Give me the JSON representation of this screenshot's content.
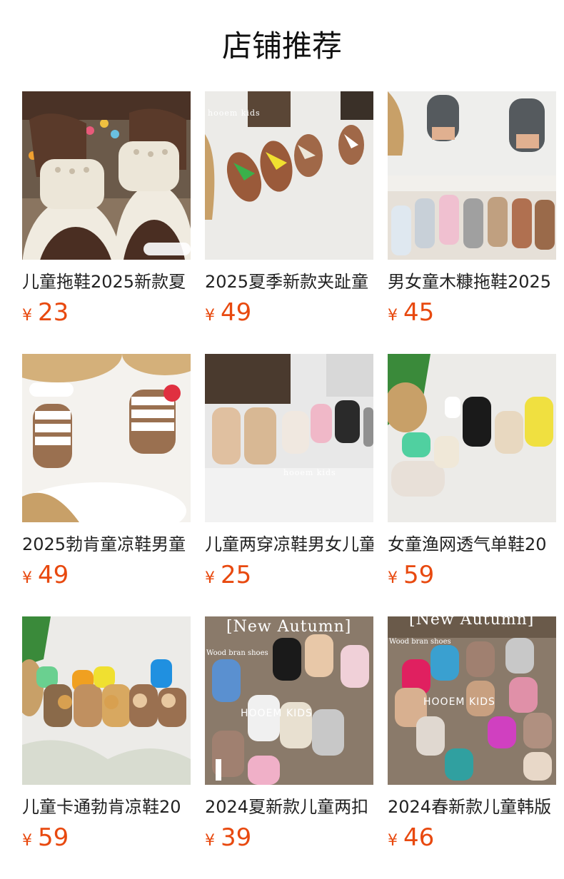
{
  "page_title": "店铺推荐",
  "currency_symbol": "¥",
  "accent_color": "#e8490f",
  "products": [
    {
      "title": "儿童拖鞋2025新款夏",
      "price": "23"
    },
    {
      "title": "2025夏季新款夹趾童",
      "price": "49"
    },
    {
      "title": "男女童木糠拖鞋2025",
      "price": "45"
    },
    {
      "title": "2025勃肯童凉鞋男童",
      "price": "49"
    },
    {
      "title": "儿童两穿凉鞋男女儿童",
      "price": "25"
    },
    {
      "title": "女童渔网透气单鞋20",
      "price": "59"
    },
    {
      "title": "儿童卡通勃肯凉鞋20",
      "price": "59"
    },
    {
      "title": "2024夏新款儿童两扣",
      "price": "39"
    },
    {
      "title": "2024春新款儿童韩版",
      "price": "46"
    }
  ],
  "image_texts": {
    "p2": "hooem  kids",
    "p5": "hooem  kids",
    "p8_banner": "[New Autumn]",
    "p8_sub": "Wood bran shoes",
    "p8_brand": "HOOEM  KIDS",
    "p9_banner": "[New Autumn]",
    "p9_sub": "Wood bran shoes",
    "p9_brand": "HOOEM  KIDS"
  }
}
